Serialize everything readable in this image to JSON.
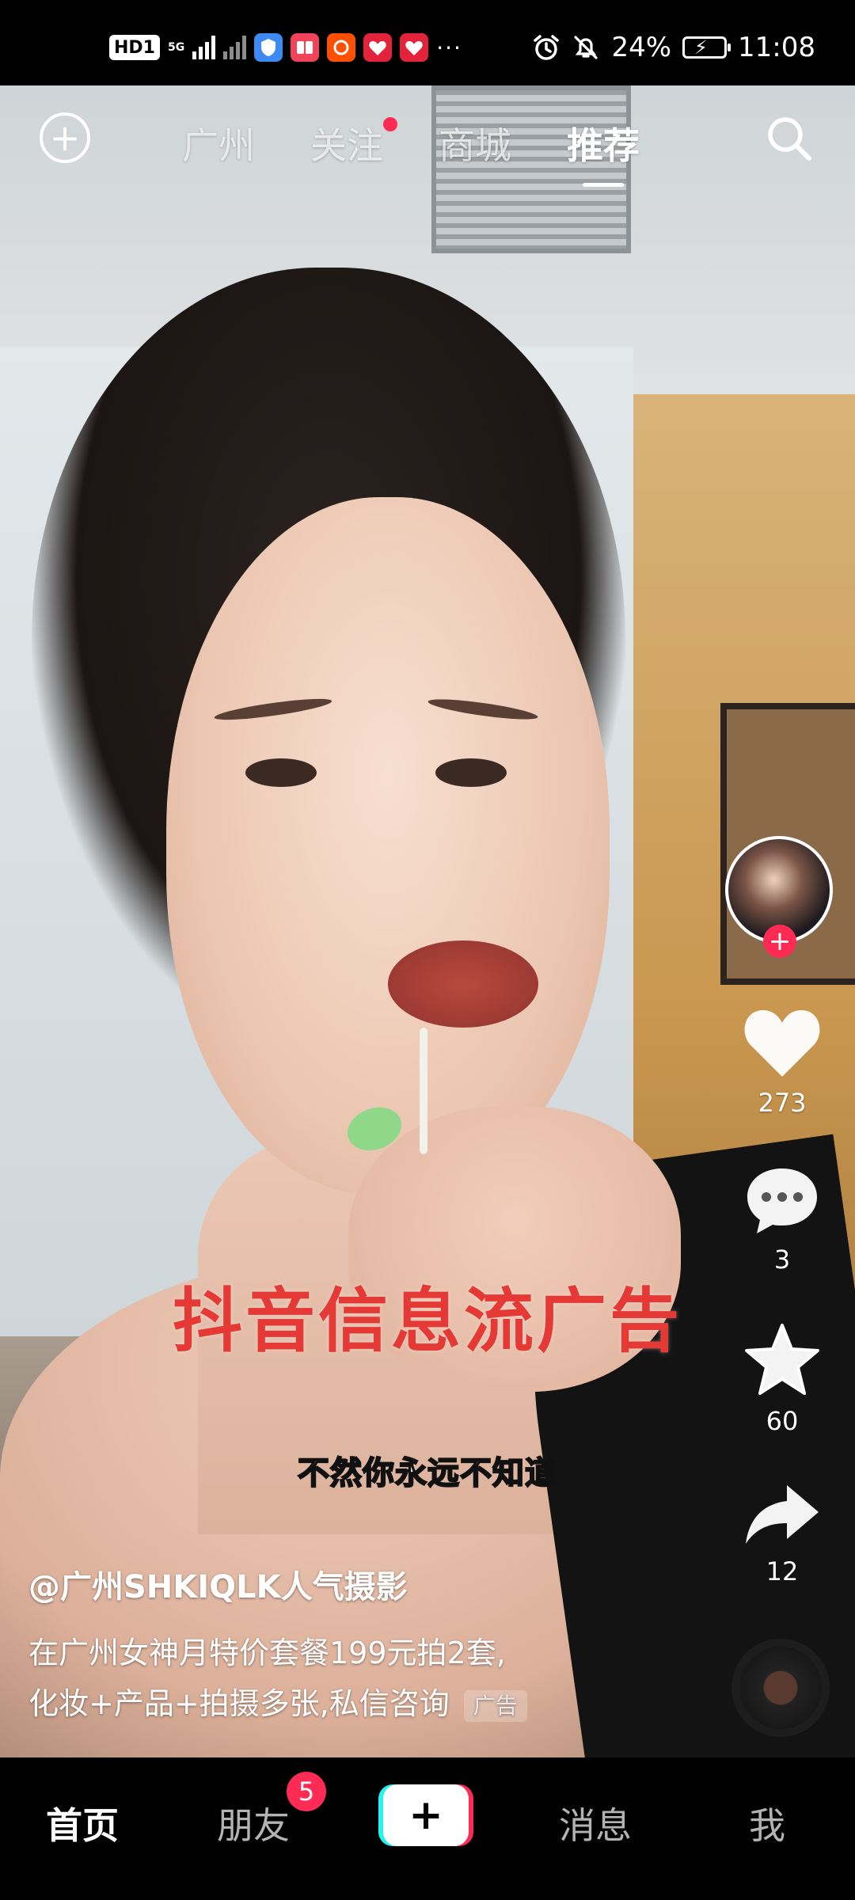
{
  "status_bar": {
    "hd_badge": "HD1",
    "network": "5G",
    "battery_percent": "24%",
    "time": "11:08",
    "app_icons": [
      "shield-icon",
      "reader-icon",
      "taobao-icon",
      "heart-app-icon",
      "heart-app-icon"
    ],
    "more": "···"
  },
  "top_nav": {
    "tabs": [
      {
        "label": "广州",
        "active": false
      },
      {
        "label": "关注",
        "active": false,
        "dot": true
      },
      {
        "label": "商城",
        "active": false
      },
      {
        "label": "推荐",
        "active": true
      }
    ]
  },
  "video": {
    "overlay_text": "抖音信息流广告",
    "subtitle": "不然你永远不知道"
  },
  "right_rail": {
    "likes": "273",
    "comments": "3",
    "favorites": "60",
    "shares": "12"
  },
  "caption": {
    "author": "@广州SHKIQLK人气摄影",
    "line1": "在广州女神月特价套餐199元拍2套,",
    "line2": "化妆+产品+拍摄多张,私信咨询",
    "ad_tag": "广告"
  },
  "bottom_nav": {
    "home": "首页",
    "friends": "朋友",
    "friends_badge": "5",
    "create": "+",
    "messages": "消息",
    "me": "我"
  },
  "colors": {
    "accent": "#fe2c55",
    "overlay_text": "#e53935",
    "cyan": "#25f4ee"
  }
}
